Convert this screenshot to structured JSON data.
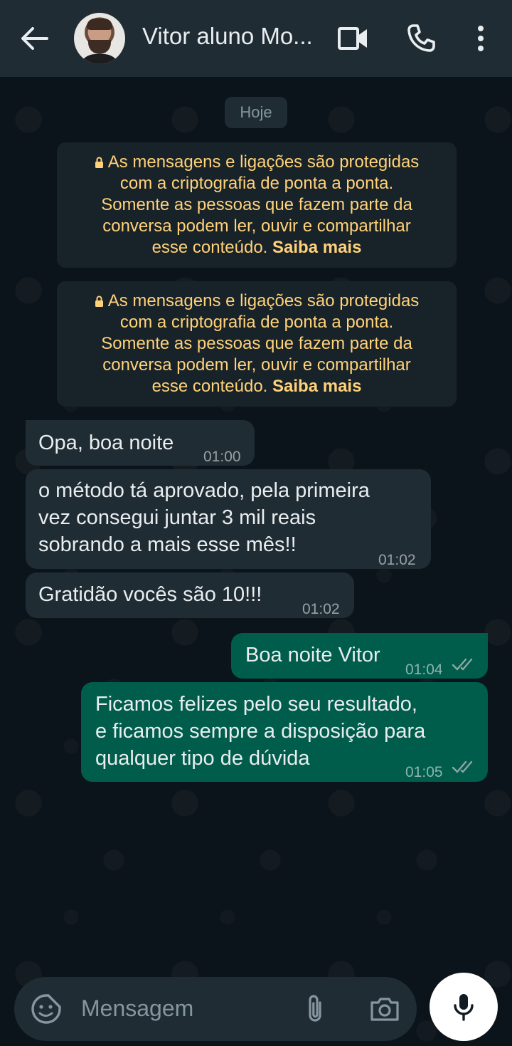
{
  "contact": {
    "name": "Vitor aluno Mo..."
  },
  "date_chip": "Hoje",
  "encryption_notice": {
    "lines": [
      "As mensagens e ligações são protegidas",
      "com a criptografia de ponta a ponta.",
      "Somente as pessoas que fazem parte da",
      "conversa podem ler, ouvir e compartilhar",
      "esse conteúdo."
    ],
    "link": "Saiba mais"
  },
  "messages": [
    {
      "direction": "incoming",
      "lines": [
        "Opa, boa noite"
      ],
      "time": "01:00"
    },
    {
      "direction": "incoming",
      "lines": [
        "o método tá aprovado, pela primeira",
        "vez consegui juntar 3 mil reais",
        "sobrando a mais esse mês!!"
      ],
      "time": "01:02"
    },
    {
      "direction": "incoming",
      "lines": [
        "Gratidão vocês são 10!!!"
      ],
      "time": "01:02"
    },
    {
      "direction": "outgoing",
      "lines": [
        "Boa noite Vitor"
      ],
      "time": "01:04",
      "status": "read"
    },
    {
      "direction": "outgoing",
      "lines": [
        "Ficamos felizes pelo seu resultado,",
        "e ficamos sempre a disposição para",
        "qualquer tipo de dúvida"
      ],
      "time": "01:05",
      "status": "read"
    }
  ],
  "composer": {
    "placeholder": "Mensagem"
  },
  "icons": {
    "back": "arrow-left-icon",
    "video": "video-camera-icon",
    "call": "phone-icon",
    "menu": "more-vertical-icon",
    "sticker": "sticker-icon",
    "attach": "paperclip-icon",
    "camera": "camera-icon",
    "mic": "microphone-icon"
  },
  "colors": {
    "header": "#1f2c34",
    "background": "#0b141a",
    "incoming_bubble": "#1f2c34",
    "outgoing_bubble": "#005c4b",
    "notice_text": "#ffd279",
    "read_ticks": "#8696a0"
  }
}
